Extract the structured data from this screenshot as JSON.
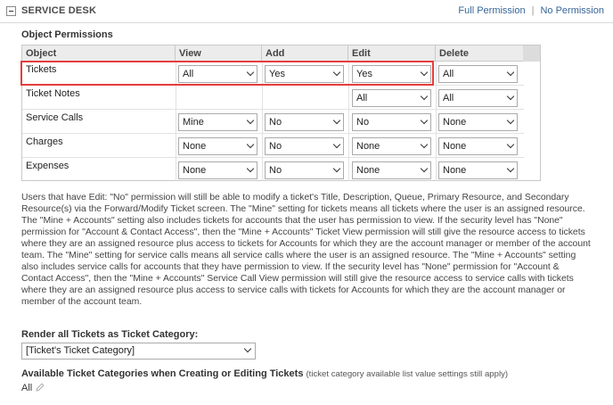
{
  "section": {
    "title": "SERVICE DESK",
    "full_permission": "Full Permission",
    "separator": "|",
    "no_permission": "No Permission"
  },
  "object_permissions": {
    "heading": "Object Permissions",
    "columns": [
      "Object",
      "View",
      "Add",
      "Edit",
      "Delete"
    ],
    "rows": [
      {
        "label": "Tickets",
        "view": "All",
        "add": "Yes",
        "edit": "Yes",
        "delete": "All"
      },
      {
        "label": "Ticket Notes",
        "view": null,
        "add": null,
        "edit": "All",
        "delete": "All"
      },
      {
        "label": "Service Calls",
        "view": "Mine",
        "add": "No",
        "edit": "No",
        "delete": "None"
      },
      {
        "label": "Charges",
        "view": "None",
        "add": "No",
        "edit": "None",
        "delete": "None"
      },
      {
        "label": "Expenses",
        "view": "None",
        "add": "No",
        "edit": "None",
        "delete": "None"
      }
    ]
  },
  "help_text": "Users that have Edit: \"No\" permission will still be able to modify a ticket's Title, Description, Queue, Primary Resource, and Secondary Resource(s) via the Forward/Modify Ticket screen. The \"Mine\" setting for tickets means all tickets where the user is an assigned resource. The \"Mine + Accounts\" setting also includes tickets for accounts that the user has permission to view. If the security level has \"None\" permission for \"Account & Contact Access\", then the \"Mine + Accounts\" Ticket View permission will still give the resource access to tickets where they are an assigned resource plus access to tickets for Accounts for which they are the account manager or member of the account team. The \"Mine\" setting for service calls means all service calls where the user is an assigned resource. The \"Mine + Accounts\" setting also includes service calls for accounts that they have permission to view. If the security level has \"None\" permission for \"Account & Contact Access\", then the \"Mine + Accounts\" Service Call View permission will still give the resource access to service calls with tickets where they are an assigned resource plus access to service calls with tickets for Accounts for which they are the account manager or member of the account team.",
  "render": {
    "label": "Render all Tickets as Ticket Category:",
    "value": "[Ticket's Ticket Category]"
  },
  "available": {
    "label": "Available Ticket Categories when Creating or Editing Tickets",
    "note": "(ticket category available list value settings still apply)",
    "value": "All"
  }
}
